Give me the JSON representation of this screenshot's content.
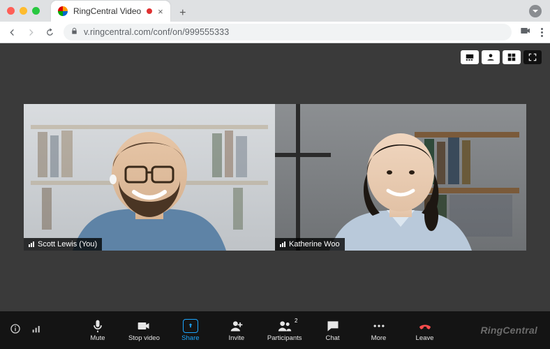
{
  "browser": {
    "tab_title": "RingCentral Video",
    "url": "v.ringcentral.com/conf/on/999555333"
  },
  "view_options": {
    "filmstrip": "filmstrip-view",
    "speaker": "speaker-view",
    "gallery": "gallery-view",
    "fullscreen": "fullscreen"
  },
  "participants": [
    {
      "name": "Scott Lewis (You)"
    },
    {
      "name": "Katherine Woo"
    }
  ],
  "participant_count_badge": "2",
  "toolbar": {
    "mute": "Mute",
    "stop_video": "Stop video",
    "share": "Share",
    "invite": "Invite",
    "participants": "Participants",
    "chat": "Chat",
    "more": "More",
    "leave": "Leave"
  },
  "brand": "RingCentral"
}
